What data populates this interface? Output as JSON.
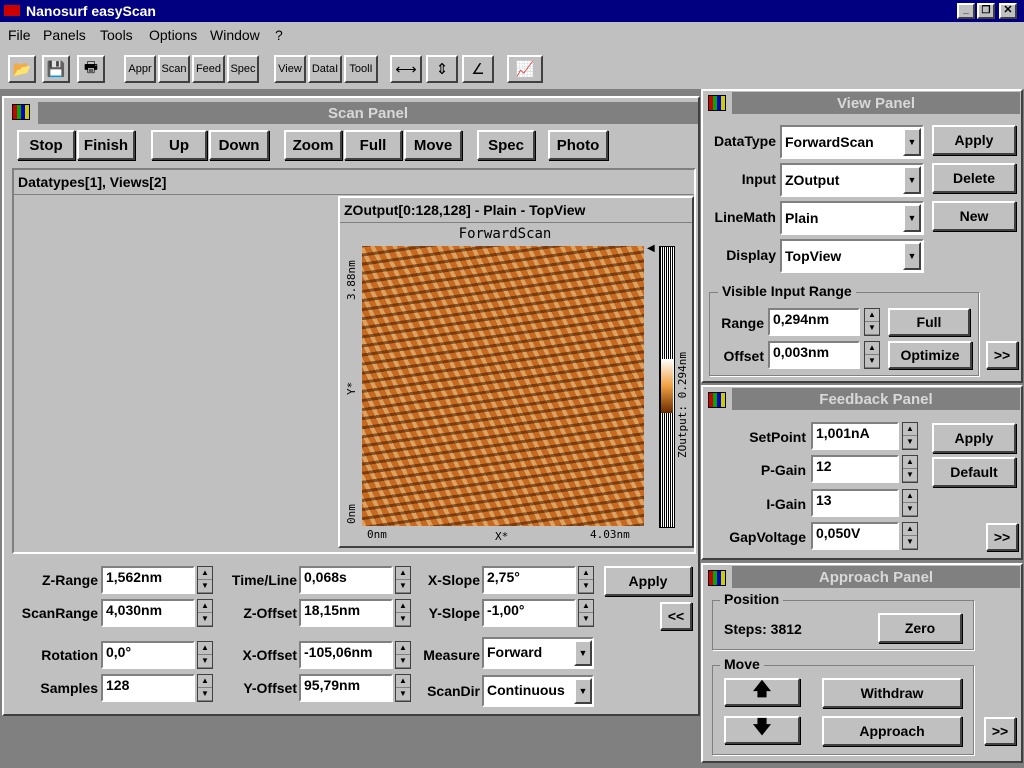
{
  "app": {
    "title": "Nanosurf easyScan"
  },
  "menu": [
    "File",
    "Panels",
    "Tools",
    "Options",
    "Window",
    "?"
  ],
  "toolbar": {
    "appr": "Appr",
    "scan": "Scan",
    "feed": "Feed",
    "spec": "Spec",
    "view": "View",
    "data": "DataI",
    "tool": "ToolI"
  },
  "scan_panel": {
    "title": "Scan Panel",
    "buttons": {
      "stop": "Stop",
      "finish": "Finish",
      "up": "Up",
      "down": "Down",
      "zoom": "Zoom",
      "full": "Full",
      "move": "Move",
      "spec": "Spec",
      "photo": "Photo"
    },
    "datatypes_header": "Datatypes[1], Views[2]",
    "image_header": "ZOutput[0:128,128] - Plain - TopView",
    "image_title": "ForwardScan",
    "y_top": "3.88nm",
    "y_bottom": "0nm",
    "y_axis": "Y*",
    "x_left": "0nm",
    "x_right": "4.03nm",
    "x_axis": "X*",
    "colorbar_label": "ZOutput: 0.294nm",
    "params": {
      "zrange_label": "Z-Range",
      "zrange": "1,562nm",
      "scanrange_label": "ScanRange",
      "scanrange": "4,030nm",
      "rotation_label": "Rotation",
      "rotation": "0,0°",
      "samples_label": "Samples",
      "samples": "128",
      "timeline_label": "Time/Line",
      "timeline": "0,068s",
      "zoffset_label": "Z-Offset",
      "zoffset": "18,15nm",
      "xoffset_label": "X-Offset",
      "xoffset": "-105,06nm",
      "yoffset_label": "Y-Offset",
      "yoffset": "95,79nm",
      "xslope_label": "X-Slope",
      "xslope": "2,75°",
      "yslope_label": "Y-Slope",
      "yslope": "-1,00°",
      "measure_label": "Measure",
      "measure": "Forward",
      "scandir_label": "ScanDir",
      "scandir": "Continuous",
      "apply": "Apply",
      "collapse": "<<"
    }
  },
  "view_panel": {
    "title": "View Panel",
    "datatype_label": "DataType",
    "datatype": "ForwardScan",
    "input_label": "Input",
    "input": "ZOutput",
    "linemath_label": "LineMath",
    "linemath": "Plain",
    "display_label": "Display",
    "display": "TopView",
    "apply": "Apply",
    "delete": "Delete",
    "new": "New",
    "range_group": "Visible Input Range",
    "range_label": "Range",
    "range": "0,294nm",
    "offset_label": "Offset",
    "offset": "0,003nm",
    "full": "Full",
    "optimize": "Optimize",
    "expand": ">>"
  },
  "feedback_panel": {
    "title": "Feedback Panel",
    "setpoint_label": "SetPoint",
    "setpoint": "1,001nA",
    "pgain_label": "P-Gain",
    "pgain": "12",
    "igain_label": "I-Gain",
    "igain": "13",
    "gap_label": "GapVoltage",
    "gap": "0,050V",
    "apply": "Apply",
    "default": "Default",
    "expand": ">>"
  },
  "approach_panel": {
    "title": "Approach Panel",
    "position_group": "Position",
    "steps": "Steps: 3812",
    "zero": "Zero",
    "move_group": "Move",
    "withdraw": "Withdraw",
    "approach": "Approach",
    "expand": ">>"
  }
}
